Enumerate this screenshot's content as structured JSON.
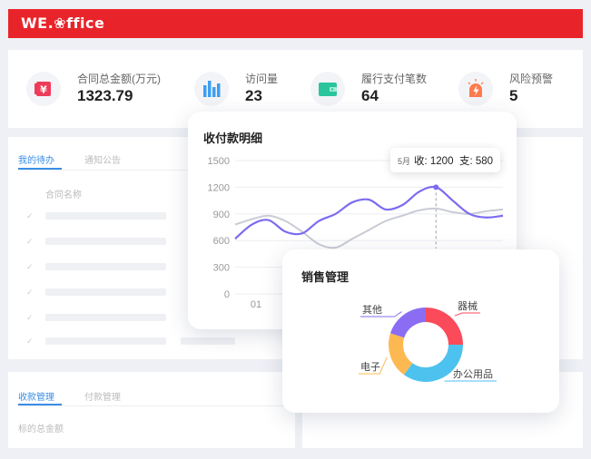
{
  "brand": {
    "logo": "WE.❀ffice",
    "color": "#e8242a"
  },
  "stats": [
    {
      "icon": "yuan-badge-icon",
      "label": "合同总金额(万元)",
      "value": "1323.79"
    },
    {
      "icon": "bar-chart-icon",
      "label": "访问量",
      "value": "23"
    },
    {
      "icon": "wallet-icon",
      "label": "履行支付笔数",
      "value": "64"
    },
    {
      "icon": "warning-lightning-icon",
      "label": "风险预警",
      "value": "5"
    }
  ],
  "todo_panel": {
    "tabs": [
      "我的待办",
      "通知公告"
    ],
    "active_tab": 0,
    "column_header": "合同名称"
  },
  "bottom_panel": {
    "tabs": [
      "收款管理",
      "付款管理"
    ],
    "active_tab": 0,
    "field_label": "标的总金额"
  },
  "payment_chart": {
    "title": "收付款明细",
    "tooltip": {
      "month": "5月",
      "receive": "收: 1200",
      "pay": "支: 580"
    },
    "chart_data": {
      "type": "line",
      "x_tick_labels": [
        "01"
      ],
      "ylim": [
        0,
        1500
      ],
      "y_ticks": [
        0,
        300,
        600,
        900,
        1200,
        1500
      ],
      "grid": true,
      "series": [
        {
          "values": [
            620,
            780,
            830,
            700,
            680,
            820,
            900,
            1030,
            1060,
            950,
            1000,
            1150,
            1200,
            1050,
            900,
            860,
            880
          ],
          "color": "#7b6cf0"
        },
        {
          "values": [
            780,
            840,
            880,
            820,
            700,
            560,
            520,
            620,
            720,
            820,
            880,
            940,
            960,
            920,
            900,
            930,
            950
          ],
          "color": "#c9cbd6"
        }
      ],
      "highlight_index": 12
    }
  },
  "sales_chart": {
    "title": "销售管理",
    "chart_data": {
      "type": "pie",
      "labels": [
        "器械",
        "办公用品",
        "电子",
        "其他"
      ],
      "values": [
        25,
        35,
        20,
        20
      ],
      "colors": [
        "#fb4b5a",
        "#4ec2ee",
        "#fdb951",
        "#8a6df2"
      ],
      "donut": true
    }
  }
}
